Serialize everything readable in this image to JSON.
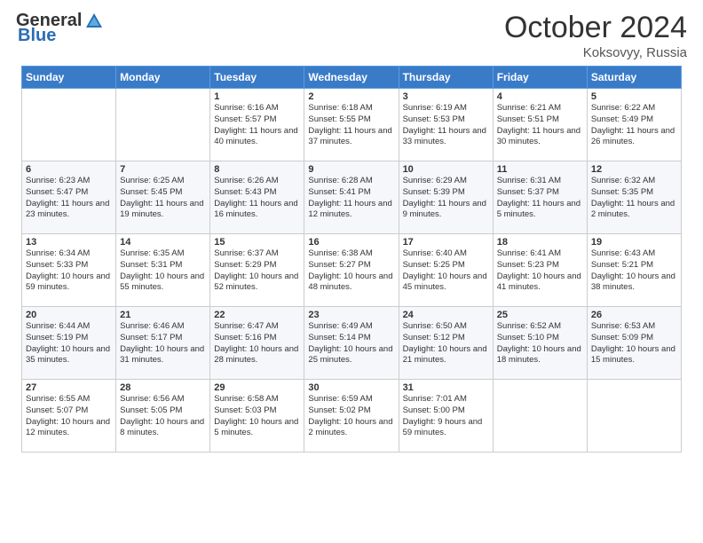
{
  "logo": {
    "general": "General",
    "blue": "Blue"
  },
  "header": {
    "month_title": "October 2024",
    "subtitle": "Koksovyy, Russia"
  },
  "days_of_week": [
    "Sunday",
    "Monday",
    "Tuesday",
    "Wednesday",
    "Thursday",
    "Friday",
    "Saturday"
  ],
  "weeks": [
    [
      {
        "day": "",
        "sunrise": "",
        "sunset": "",
        "daylight": ""
      },
      {
        "day": "",
        "sunrise": "",
        "sunset": "",
        "daylight": ""
      },
      {
        "day": "1",
        "sunrise": "Sunrise: 6:16 AM",
        "sunset": "Sunset: 5:57 PM",
        "daylight": "Daylight: 11 hours and 40 minutes."
      },
      {
        "day": "2",
        "sunrise": "Sunrise: 6:18 AM",
        "sunset": "Sunset: 5:55 PM",
        "daylight": "Daylight: 11 hours and 37 minutes."
      },
      {
        "day": "3",
        "sunrise": "Sunrise: 6:19 AM",
        "sunset": "Sunset: 5:53 PM",
        "daylight": "Daylight: 11 hours and 33 minutes."
      },
      {
        "day": "4",
        "sunrise": "Sunrise: 6:21 AM",
        "sunset": "Sunset: 5:51 PM",
        "daylight": "Daylight: 11 hours and 30 minutes."
      },
      {
        "day": "5",
        "sunrise": "Sunrise: 6:22 AM",
        "sunset": "Sunset: 5:49 PM",
        "daylight": "Daylight: 11 hours and 26 minutes."
      }
    ],
    [
      {
        "day": "6",
        "sunrise": "Sunrise: 6:23 AM",
        "sunset": "Sunset: 5:47 PM",
        "daylight": "Daylight: 11 hours and 23 minutes."
      },
      {
        "day": "7",
        "sunrise": "Sunrise: 6:25 AM",
        "sunset": "Sunset: 5:45 PM",
        "daylight": "Daylight: 11 hours and 19 minutes."
      },
      {
        "day": "8",
        "sunrise": "Sunrise: 6:26 AM",
        "sunset": "Sunset: 5:43 PM",
        "daylight": "Daylight: 11 hours and 16 minutes."
      },
      {
        "day": "9",
        "sunrise": "Sunrise: 6:28 AM",
        "sunset": "Sunset: 5:41 PM",
        "daylight": "Daylight: 11 hours and 12 minutes."
      },
      {
        "day": "10",
        "sunrise": "Sunrise: 6:29 AM",
        "sunset": "Sunset: 5:39 PM",
        "daylight": "Daylight: 11 hours and 9 minutes."
      },
      {
        "day": "11",
        "sunrise": "Sunrise: 6:31 AM",
        "sunset": "Sunset: 5:37 PM",
        "daylight": "Daylight: 11 hours and 5 minutes."
      },
      {
        "day": "12",
        "sunrise": "Sunrise: 6:32 AM",
        "sunset": "Sunset: 5:35 PM",
        "daylight": "Daylight: 11 hours and 2 minutes."
      }
    ],
    [
      {
        "day": "13",
        "sunrise": "Sunrise: 6:34 AM",
        "sunset": "Sunset: 5:33 PM",
        "daylight": "Daylight: 10 hours and 59 minutes."
      },
      {
        "day": "14",
        "sunrise": "Sunrise: 6:35 AM",
        "sunset": "Sunset: 5:31 PM",
        "daylight": "Daylight: 10 hours and 55 minutes."
      },
      {
        "day": "15",
        "sunrise": "Sunrise: 6:37 AM",
        "sunset": "Sunset: 5:29 PM",
        "daylight": "Daylight: 10 hours and 52 minutes."
      },
      {
        "day": "16",
        "sunrise": "Sunrise: 6:38 AM",
        "sunset": "Sunset: 5:27 PM",
        "daylight": "Daylight: 10 hours and 48 minutes."
      },
      {
        "day": "17",
        "sunrise": "Sunrise: 6:40 AM",
        "sunset": "Sunset: 5:25 PM",
        "daylight": "Daylight: 10 hours and 45 minutes."
      },
      {
        "day": "18",
        "sunrise": "Sunrise: 6:41 AM",
        "sunset": "Sunset: 5:23 PM",
        "daylight": "Daylight: 10 hours and 41 minutes."
      },
      {
        "day": "19",
        "sunrise": "Sunrise: 6:43 AM",
        "sunset": "Sunset: 5:21 PM",
        "daylight": "Daylight: 10 hours and 38 minutes."
      }
    ],
    [
      {
        "day": "20",
        "sunrise": "Sunrise: 6:44 AM",
        "sunset": "Sunset: 5:19 PM",
        "daylight": "Daylight: 10 hours and 35 minutes."
      },
      {
        "day": "21",
        "sunrise": "Sunrise: 6:46 AM",
        "sunset": "Sunset: 5:17 PM",
        "daylight": "Daylight: 10 hours and 31 minutes."
      },
      {
        "day": "22",
        "sunrise": "Sunrise: 6:47 AM",
        "sunset": "Sunset: 5:16 PM",
        "daylight": "Daylight: 10 hours and 28 minutes."
      },
      {
        "day": "23",
        "sunrise": "Sunrise: 6:49 AM",
        "sunset": "Sunset: 5:14 PM",
        "daylight": "Daylight: 10 hours and 25 minutes."
      },
      {
        "day": "24",
        "sunrise": "Sunrise: 6:50 AM",
        "sunset": "Sunset: 5:12 PM",
        "daylight": "Daylight: 10 hours and 21 minutes."
      },
      {
        "day": "25",
        "sunrise": "Sunrise: 6:52 AM",
        "sunset": "Sunset: 5:10 PM",
        "daylight": "Daylight: 10 hours and 18 minutes."
      },
      {
        "day": "26",
        "sunrise": "Sunrise: 6:53 AM",
        "sunset": "Sunset: 5:09 PM",
        "daylight": "Daylight: 10 hours and 15 minutes."
      }
    ],
    [
      {
        "day": "27",
        "sunrise": "Sunrise: 6:55 AM",
        "sunset": "Sunset: 5:07 PM",
        "daylight": "Daylight: 10 hours and 12 minutes."
      },
      {
        "day": "28",
        "sunrise": "Sunrise: 6:56 AM",
        "sunset": "Sunset: 5:05 PM",
        "daylight": "Daylight: 10 hours and 8 minutes."
      },
      {
        "day": "29",
        "sunrise": "Sunrise: 6:58 AM",
        "sunset": "Sunset: 5:03 PM",
        "daylight": "Daylight: 10 hours and 5 minutes."
      },
      {
        "day": "30",
        "sunrise": "Sunrise: 6:59 AM",
        "sunset": "Sunset: 5:02 PM",
        "daylight": "Daylight: 10 hours and 2 minutes."
      },
      {
        "day": "31",
        "sunrise": "Sunrise: 7:01 AM",
        "sunset": "Sunset: 5:00 PM",
        "daylight": "Daylight: 9 hours and 59 minutes."
      },
      {
        "day": "",
        "sunrise": "",
        "sunset": "",
        "daylight": ""
      },
      {
        "day": "",
        "sunrise": "",
        "sunset": "",
        "daylight": ""
      }
    ]
  ]
}
